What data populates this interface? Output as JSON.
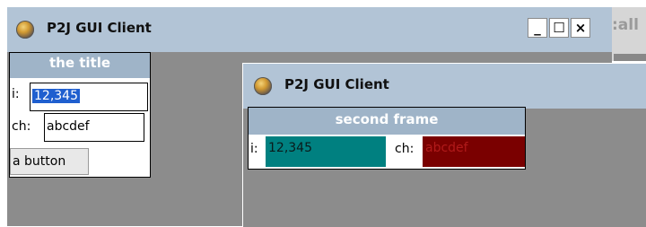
{
  "window1": {
    "title": "P2J GUI Client",
    "minimize": "_",
    "maximize": "☐",
    "close": "×"
  },
  "frame1": {
    "title": "the title",
    "i_label": "i:",
    "i_value": "12,345",
    "ch_label": "ch:",
    "ch_value": "abcdef",
    "button_label": "a button"
  },
  "window2": {
    "title": "P2J GUI Client"
  },
  "frame2": {
    "title": "second frame",
    "i_label": "i:",
    "i_value": "12,345",
    "ch_label": "ch:",
    "ch_value": "abcdef"
  },
  "background_window": {
    "partial_title": ":all"
  },
  "colors": {
    "titlebar": "#b2c4d6",
    "client": "#8c8c8c",
    "frame_title": "#9fb4c8",
    "teal_field": "#008080",
    "maroon_field": "#7a0000",
    "selection": "#1f5fcf"
  }
}
